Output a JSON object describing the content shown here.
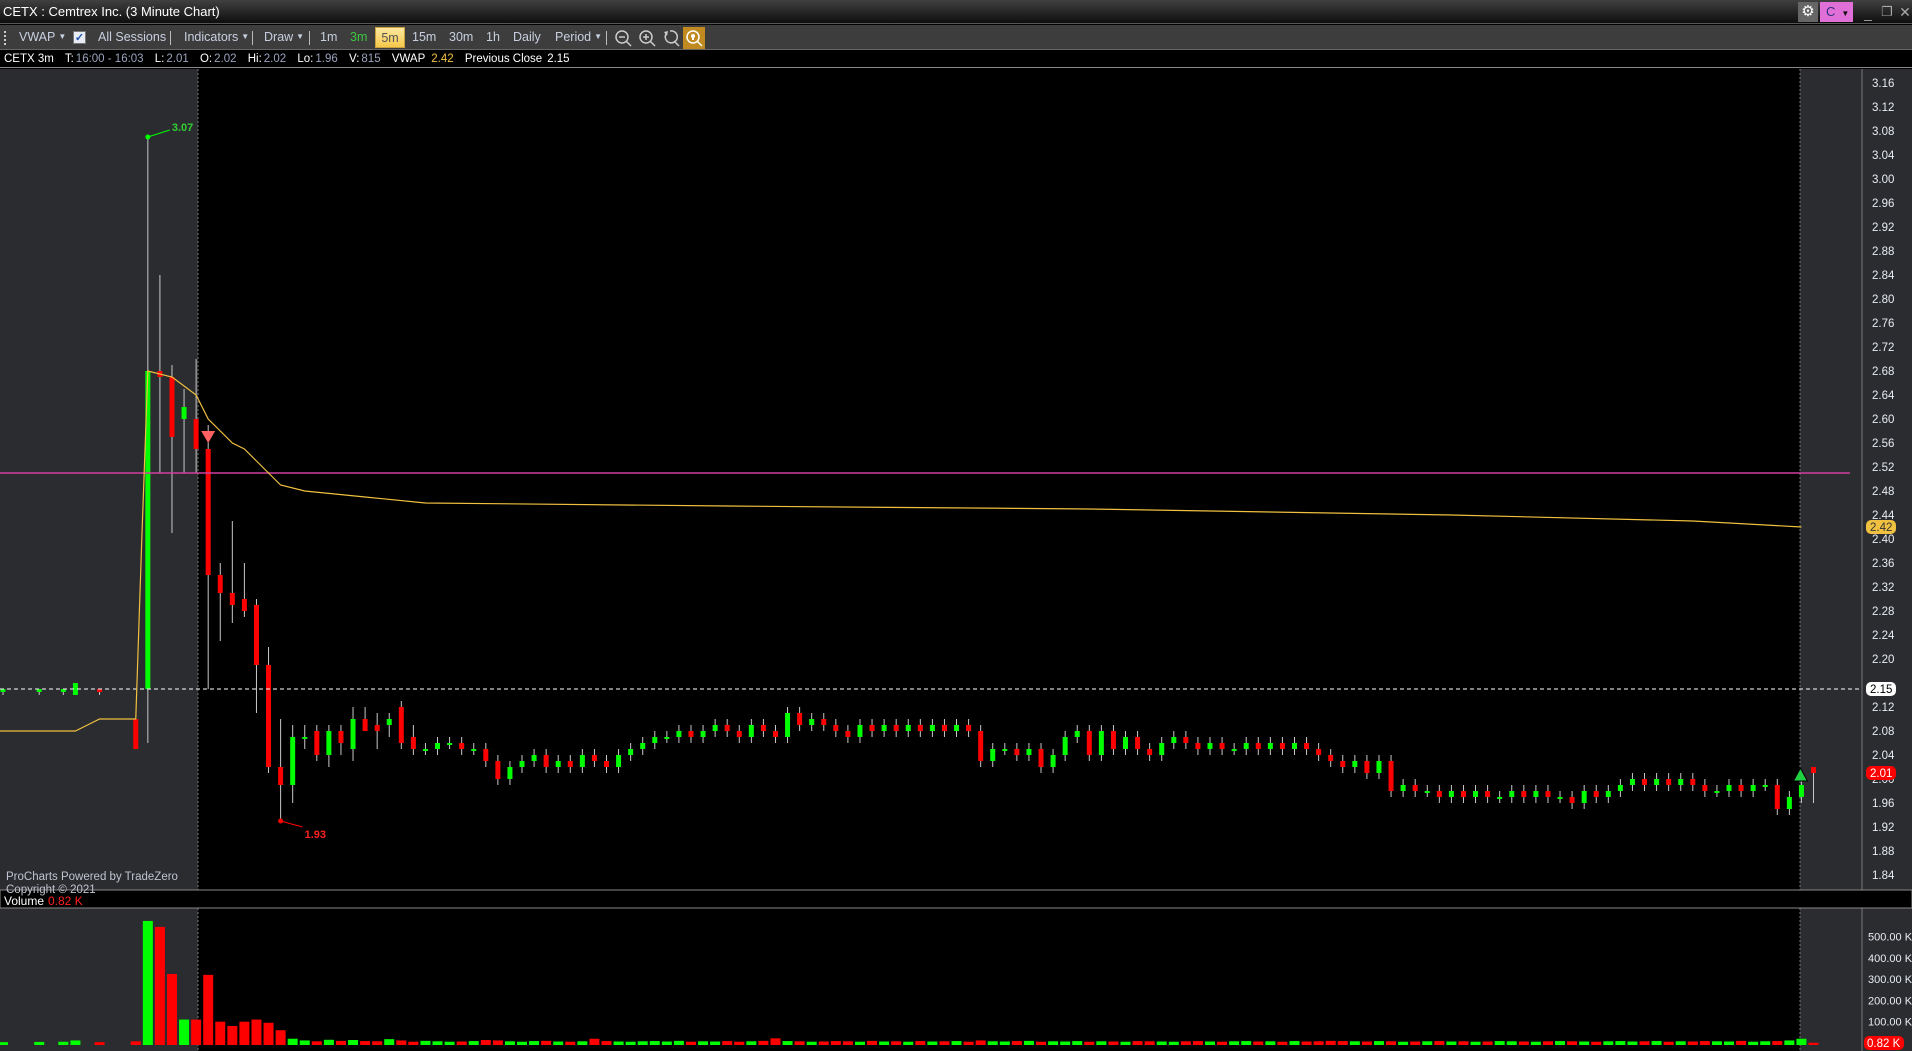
{
  "window": {
    "title": "CETX : Cemtrex Inc. (3 Minute Chart)",
    "account_badge": "C"
  },
  "toolbar": {
    "vwap": "VWAP",
    "all_sessions": "All Sessions",
    "indicators": "Indicators",
    "draw": "Draw",
    "periods": [
      "1m",
      "3m",
      "5m",
      "15m",
      "30m",
      "1h",
      "Daily"
    ],
    "active_period": "5m",
    "chart_period": "3m",
    "period": "Period"
  },
  "info": {
    "symbol": "CETX 3m",
    "t_label": "T:",
    "t_value": "16:00 - 16:03",
    "l_label": "L:",
    "l_value": "2.01",
    "o_label": "O:",
    "o_value": "2.02",
    "hi_label": "Hi:",
    "hi_value": "2.02",
    "lo_label": "Lo:",
    "lo_value": "1.96",
    "v_label": "V:",
    "v_value": "815",
    "vwap_label": "VWAP",
    "vwap_value": "2.42",
    "prev_label": "Previous Close",
    "prev_value": "2.15"
  },
  "watermark": {
    "line1": "ProCharts Powered by TradeZero",
    "line2": "Copyright © 2021"
  },
  "volume_panel": {
    "label": "Volume",
    "value": "0.82 K",
    "axis_labels": [
      "500.00 K",
      "400.00 K",
      "300.00 K",
      "200.00 K",
      "100.00 K"
    ],
    "axis_values": [
      500,
      400,
      300,
      200,
      100
    ],
    "last_badge": "0.82 K"
  },
  "colors": {
    "up": "#00ff00",
    "down": "#ff0000",
    "vwap": "#f0c040",
    "level_line": "#d040a0",
    "bg": "#000000",
    "gray": "#2b2c30"
  },
  "chart_data": {
    "type": "candlestick",
    "ylim": [
      1.82,
      3.17
    ],
    "y_ticks": [
      3.16,
      3.12,
      3.08,
      3.04,
      3.0,
      2.96,
      2.92,
      2.88,
      2.84,
      2.8,
      2.76,
      2.72,
      2.68,
      2.64,
      2.6,
      2.56,
      2.52,
      2.48,
      2.44,
      2.4,
      2.36,
      2.32,
      2.28,
      2.24,
      2.2,
      2.12,
      2.08,
      2.04,
      2.0,
      1.96,
      1.92,
      1.88,
      1.84
    ],
    "y_tick_labels": [
      "3.16",
      "3.12",
      "3.08",
      "3.04",
      "3.00",
      "2.96",
      "2.92",
      "2.88",
      "2.84",
      "2.80",
      "2.76",
      "2.72",
      "2.68",
      "2.64",
      "2.60",
      "2.56",
      "2.52",
      "2.48",
      "2.44",
      "2.40",
      "2.36",
      "2.32",
      "2.28",
      "2.24",
      "2.20",
      "2.12",
      "2.08",
      "2.04",
      "2.00",
      "1.96",
      "1.92",
      "1.88",
      "1.84"
    ],
    "ohlc_explicit": [
      [
        0,
        2.145,
        2.15,
        2.14,
        2.15
      ],
      [
        3,
        2.145,
        2.15,
        2.14,
        2.15
      ],
      [
        5,
        2.145,
        2.15,
        2.14,
        2.15
      ],
      [
        6,
        2.14,
        2.16,
        2.14,
        2.16
      ],
      [
        8,
        2.15,
        2.15,
        2.14,
        2.145
      ],
      [
        11,
        2.1,
        2.1,
        2.05,
        2.05
      ],
      [
        12,
        2.15,
        3.07,
        2.06,
        2.68
      ],
      [
        13,
        2.68,
        2.84,
        2.51,
        2.67
      ],
      [
        14,
        2.67,
        2.69,
        2.41,
        2.57
      ],
      [
        15,
        2.6,
        2.65,
        2.51,
        2.62
      ],
      [
        16,
        2.6,
        2.7,
        2.51,
        2.55
      ],
      [
        17,
        2.55,
        2.59,
        2.15,
        2.34
      ],
      [
        18,
        2.34,
        2.36,
        2.23,
        2.31
      ],
      [
        19,
        2.31,
        2.43,
        2.26,
        2.29
      ],
      [
        20,
        2.3,
        2.36,
        2.27,
        2.28
      ],
      [
        21,
        2.29,
        2.3,
        2.11,
        2.19
      ],
      [
        22,
        2.19,
        2.22,
        2.01,
        2.02
      ],
      [
        23,
        2.02,
        2.1,
        1.93,
        1.99
      ],
      [
        24,
        1.99,
        2.09,
        1.96,
        2.07
      ],
      [
        25,
        2.07,
        2.09,
        2.05,
        2.07
      ],
      [
        26,
        2.08,
        2.09,
        2.03,
        2.04
      ],
      [
        27,
        2.04,
        2.09,
        2.02,
        2.08
      ],
      [
        28,
        2.08,
        2.09,
        2.04,
        2.06
      ],
      [
        29,
        2.05,
        2.12,
        2.03,
        2.1
      ],
      [
        30,
        2.1,
        2.12,
        2.08,
        2.08
      ],
      [
        31,
        2.09,
        2.11,
        2.05,
        2.08
      ],
      [
        32,
        2.09,
        2.11,
        2.07,
        2.1
      ],
      [
        33,
        2.12,
        2.13,
        2.05,
        2.06
      ],
      [
        34,
        2.07,
        2.09,
        2.04,
        2.05
      ],
      [
        150,
        2.02,
        2.02,
        1.96,
        2.01
      ]
    ],
    "closes_from_35": [
      2.05,
      2.06,
      2.06,
      2.05,
      2.05,
      2.03,
      2.0,
      2.02,
      2.03,
      2.04,
      2.02,
      2.03,
      2.02,
      2.04,
      2.03,
      2.02,
      2.04,
      2.05,
      2.06,
      2.07,
      2.07,
      2.08,
      2.07,
      2.08,
      2.09,
      2.08,
      2.07,
      2.09,
      2.08,
      2.07,
      2.11,
      2.09,
      2.1,
      2.09,
      2.08,
      2.07,
      2.09,
      2.08,
      2.09,
      2.08,
      2.09,
      2.08,
      2.09,
      2.08,
      2.09,
      2.08,
      2.03,
      2.05,
      2.05,
      2.04,
      2.05,
      2.02,
      2.04,
      2.07,
      2.08,
      2.04,
      2.08,
      2.05,
      2.07,
      2.05,
      2.04,
      2.06,
      2.07,
      2.06,
      2.05,
      2.06,
      2.05,
      2.05,
      2.06,
      2.05,
      2.06,
      2.05,
      2.06,
      2.05,
      2.04,
      2.03,
      2.02,
      2.03,
      2.01,
      2.03,
      1.98,
      1.99,
      1.98,
      1.98,
      1.97,
      1.98,
      1.97,
      1.98,
      1.97,
      1.97,
      1.98,
      1.97,
      1.98,
      1.97,
      1.97,
      1.96,
      1.98,
      1.97,
      1.98,
      1.99,
      2.0,
      1.99,
      2.0,
      1.99,
      2.0,
      1.99,
      1.98,
      1.98,
      1.99,
      1.98,
      1.99,
      1.99,
      1.95,
      1.97,
      1.99
    ],
    "vwap": [
      [
        -1,
        2.08
      ],
      [
        6,
        2.08
      ],
      [
        7,
        2.09
      ],
      [
        8,
        2.1
      ],
      [
        11,
        2.1
      ],
      [
        11.5,
        2.4
      ],
      [
        12,
        2.68
      ],
      [
        14,
        2.67
      ],
      [
        16,
        2.64
      ],
      [
        17,
        2.6
      ],
      [
        18,
        2.58
      ],
      [
        19,
        2.56
      ],
      [
        20,
        2.55
      ],
      [
        21,
        2.53
      ],
      [
        23,
        2.49
      ],
      [
        25,
        2.48
      ],
      [
        30,
        2.47
      ],
      [
        35,
        2.46
      ],
      [
        60,
        2.455
      ],
      [
        90,
        2.45
      ],
      [
        120,
        2.44
      ],
      [
        140,
        2.43
      ],
      [
        149,
        2.42
      ]
    ],
    "volume_k": [
      4,
      0,
      0,
      5,
      0,
      6,
      12,
      0,
      4,
      0,
      0,
      8,
      573,
      545,
      324,
      110,
      110,
      320,
      100,
      80,
      100,
      110,
      95,
      60,
      20,
      12,
      8,
      15,
      10,
      14,
      9,
      8,
      18,
      12,
      6,
      10,
      8,
      6,
      7,
      9,
      14,
      12,
      8,
      6,
      9,
      10,
      7,
      6,
      8,
      20,
      9,
      7,
      6,
      8,
      9,
      7,
      10,
      6,
      8,
      7,
      9,
      6,
      8,
      10,
      22,
      9,
      8,
      6,
      7,
      9,
      8,
      6,
      10,
      7,
      8,
      6,
      9,
      7,
      8,
      9,
      6,
      12,
      8,
      7,
      9,
      10,
      6,
      8,
      7,
      9,
      6,
      8,
      7,
      6,
      9,
      8,
      7,
      6,
      8,
      9,
      7,
      6,
      8,
      9,
      7,
      8,
      6,
      9,
      7,
      8,
      10,
      9,
      8,
      7,
      9,
      8,
      6,
      7,
      8,
      9,
      7,
      8,
      6,
      7,
      9,
      8,
      7,
      6,
      8,
      9,
      8,
      7,
      6,
      8,
      9,
      7,
      8,
      9,
      6,
      8,
      7,
      9,
      8,
      7,
      10,
      6,
      8,
      9,
      12,
      20,
      1
    ],
    "high_marker": {
      "value": 3.07,
      "label": "3.07"
    },
    "low_marker": {
      "value": 1.93,
      "label": "1.93"
    },
    "previous_close": {
      "value": 2.15,
      "label": "2.15"
    },
    "vwap_badge": {
      "value": 2.42,
      "label": "2.42"
    },
    "last_price_badge": {
      "value": 2.01,
      "label": "2.01"
    },
    "level_line": 2.51,
    "sell_signal_index": 17,
    "buy_signal_index": 149
  }
}
